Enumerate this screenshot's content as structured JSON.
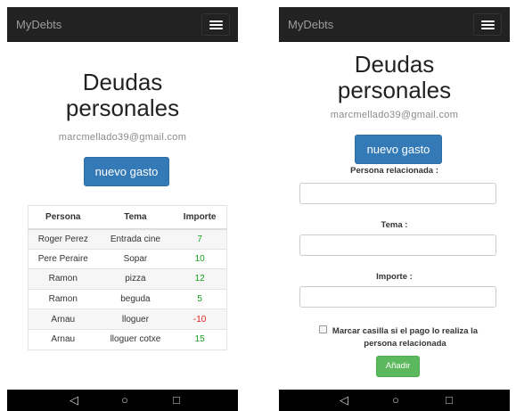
{
  "app": {
    "brand": "MyDebts"
  },
  "system_nav": {
    "back": "◁",
    "home": "○",
    "recents": "□"
  },
  "list_screen": {
    "title_line1": "Deudas",
    "title_line2": "personales",
    "email": "marcmellado39@gmail.com",
    "new_button": "nuevo gasto",
    "table": {
      "headers": [
        "Persona",
        "Tema",
        "Importe"
      ],
      "rows": [
        {
          "persona": "Roger Perez",
          "tema": "Entrada cine",
          "importe": "7"
        },
        {
          "persona": "Pere Peraire",
          "tema": "Sopar",
          "importe": "10"
        },
        {
          "persona": "Ramon",
          "tema": "pizza",
          "importe": "12"
        },
        {
          "persona": "Ramon",
          "tema": "beguda",
          "importe": "5"
        },
        {
          "persona": "Arnau",
          "tema": "lloguer",
          "importe": "-10"
        },
        {
          "persona": "Arnau",
          "tema": "lloguer cotxe",
          "importe": "15"
        }
      ]
    },
    "colors": {
      "positive": "#16a31c",
      "negative": "#e02020"
    }
  },
  "form_screen": {
    "title_line1": "Deudas",
    "title_line2": "personales",
    "email": "marcmellado39@gmail.com",
    "new_button": "nuevo gasto",
    "label_persona": "Persona relacionada :",
    "label_tema": "Tema :",
    "label_importe": "Importe :",
    "checkbox_label": "Marcar casilla si el pago lo realiza la persona relacionada",
    "submit_button": "Añadir"
  }
}
